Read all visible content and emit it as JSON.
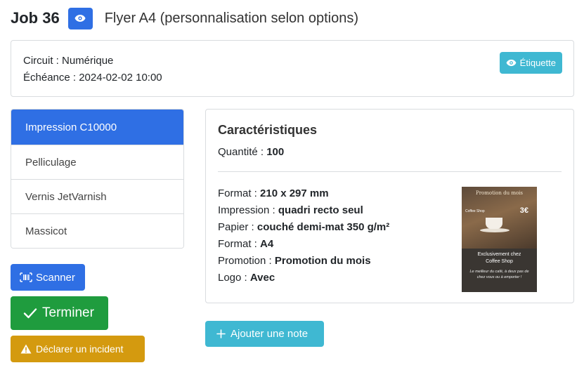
{
  "header": {
    "job_label": "Job 36",
    "subtitle": "Flyer A4 (personnalisation selon options)"
  },
  "info": {
    "circuit_label": "Circuit : ",
    "circuit_value": "Numérique",
    "due_label": "Échéance : ",
    "due_value": "2024-02-02 10:00",
    "label_button": "Étiquette"
  },
  "steps": [
    {
      "label": "Impression C10000",
      "active": true
    },
    {
      "label": "Pelliculage",
      "active": false
    },
    {
      "label": "Vernis JetVarnish",
      "active": false
    },
    {
      "label": "Massicot",
      "active": false
    }
  ],
  "actions": {
    "scan": "Scanner",
    "finish": "Terminer",
    "incident": "Déclarer un incident",
    "add_note": "Ajouter une note"
  },
  "characteristics": {
    "title": "Caractéristiques",
    "quantity_label": "Quantité : ",
    "quantity_value": "100",
    "specs": [
      {
        "label": "Format : ",
        "value": "210 x 297 mm"
      },
      {
        "label": "Impression : ",
        "value": "quadri recto seul"
      },
      {
        "label": "Papier : ",
        "value": "couché demi-mat 350 g/m²"
      },
      {
        "label": "Format : ",
        "value": "A4"
      },
      {
        "label": "Promotion : ",
        "value": "Promotion du mois"
      },
      {
        "label": "Logo : ",
        "value": "Avec"
      }
    ]
  },
  "flyer": {
    "heading": "Promotion du mois",
    "shop_sign": "Coffee Shop",
    "price": "3€",
    "exclusive_line1": "Exclusivement chez",
    "exclusive_line2": "Coffee Shop",
    "tagline": "Le meilleur du café, à deux pas de chez vous ou à emporter !"
  },
  "colors": {
    "primary": "#2f6fe4",
    "info": "#3fb8d2",
    "success": "#1f9c3e",
    "warning": "#d49a0f"
  },
  "icons": {
    "view": "eye-icon",
    "scan": "barcode-icon",
    "finish": "check-icon",
    "incident": "warning-icon",
    "add_note": "plus-icon"
  }
}
